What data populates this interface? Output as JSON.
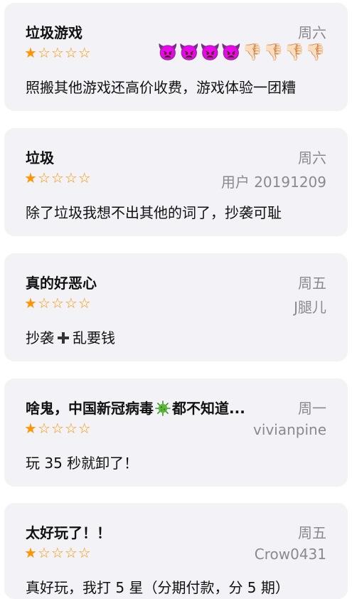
{
  "reviews": [
    {
      "title": "垃圾游戏",
      "date": "周六",
      "stars": 1,
      "author": "",
      "emojis": "👿👿👿👿👎🏻👎🏻👎🏻👎🏻",
      "body": "照搬其他游戏还高价收费，游戏体验一团糟"
    },
    {
      "title": "垃圾",
      "date": "周六",
      "stars": 1,
      "author": "用户 20191209",
      "emojis": "",
      "body": "除了垃圾我想不出其他的词了，抄袭可耻"
    },
    {
      "title": "真的好恶心",
      "date": "周五",
      "stars": 1,
      "author": "J腿儿",
      "emojis": "",
      "body_before": "抄袭",
      "body_after": "乱要钱"
    },
    {
      "title_before": "啥鬼，中国新冠病毒",
      "title_after": "都不知道...",
      "date": "周一",
      "stars": 1,
      "author": "vivianpine",
      "emojis": "",
      "body": "玩 35 秒就卸了！"
    },
    {
      "title": "太好玩了！！",
      "date": "周五",
      "stars": 1,
      "author": "Crow0431",
      "emojis": "",
      "body": "真好玩，我打 5 星（分期付款，分 5 期）"
    }
  ],
  "star_glyphs": {
    "filled": "★",
    "empty": "☆"
  },
  "colors": {
    "card_background": "#f2f2f7",
    "star": "#ff9500",
    "secondary_text": "#8a8a8e",
    "primary_text": "#111111"
  },
  "icons": {
    "virus": "virus-icon",
    "plus": "plus-icon"
  }
}
